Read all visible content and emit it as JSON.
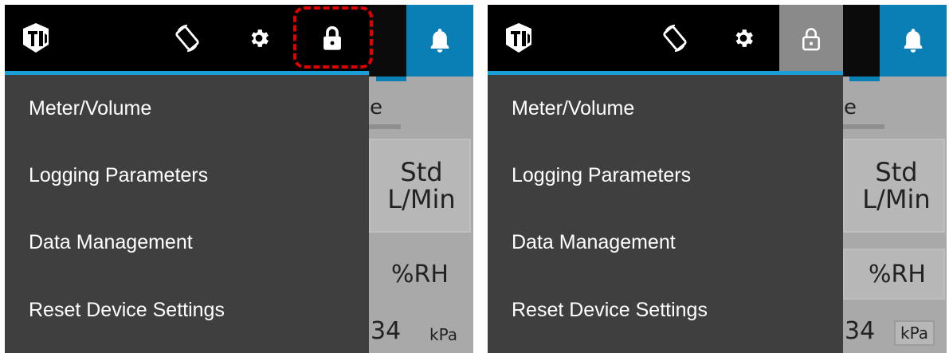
{
  "panels": [
    {
      "id": "locked",
      "menu_items": [
        "Meter/Volume",
        "Logging Parameters",
        "Data Management",
        "Reset Device Settings"
      ],
      "lock_state": "locked",
      "lock_highlighted": true,
      "background_peek": {
        "partial_tab": "e",
        "flow_unit": "Std\nL/Min",
        "humidity_unit": "%RH",
        "pressure_value": "34",
        "pressure_unit": "kPa"
      }
    },
    {
      "id": "unlocked",
      "menu_items": [
        "Meter/Volume",
        "Logging Parameters",
        "Data Management",
        "Reset Device Settings"
      ],
      "lock_state": "unlocked",
      "lock_highlighted": false,
      "background_peek": {
        "partial_tab": "e",
        "flow_unit": "Std\nL/Min",
        "humidity_unit": "%RH",
        "pressure_value": "34",
        "pressure_unit": "kPa"
      }
    }
  ],
  "icons": {
    "logo": "tsi-logo",
    "rotate": "screen-rotation-icon",
    "settings": "gear-icon",
    "lock_closed": "lock-icon",
    "lock_open": "unlock-icon",
    "alarm": "bell-icon"
  },
  "colors": {
    "topbar": "#000000",
    "drawer": "#3f3f3f",
    "accent": "#1a9ed8",
    "bell_bg": "#0a7fb5",
    "highlight": "#e00000",
    "unlocked_icon_bg": "#8a8a8a"
  }
}
